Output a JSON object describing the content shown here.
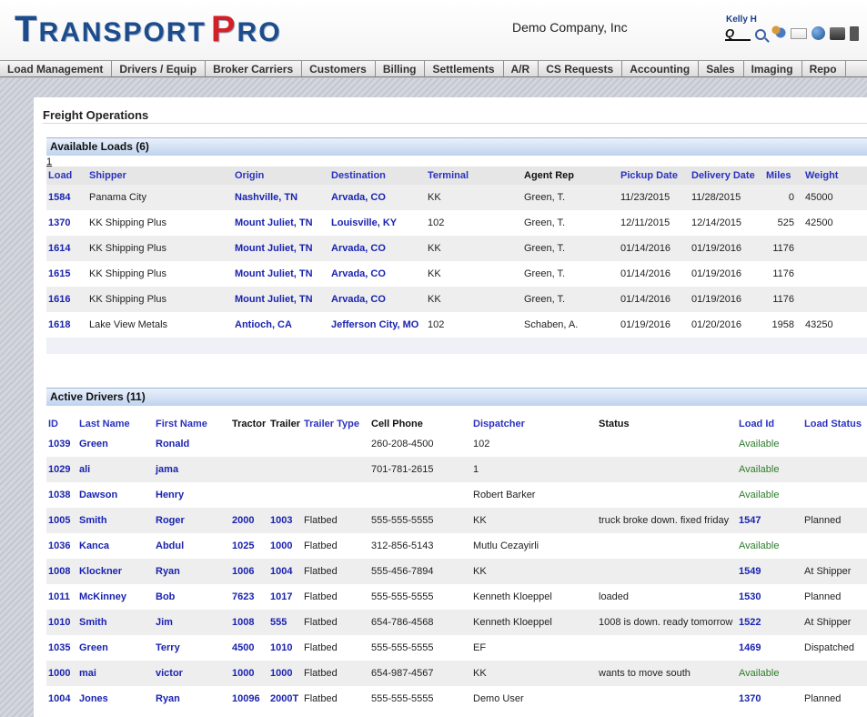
{
  "header": {
    "logo_part1_cap": "T",
    "logo_part1_rest": "RANSPORT",
    "logo_part2_cap": "P",
    "logo_part2_rest": "RO",
    "company": "Demo Company, Inc",
    "user": "Kelly H",
    "icons": [
      "quick-search-icon",
      "search-icon",
      "contacts-icon",
      "mail-icon",
      "globe-icon",
      "print-icon",
      "document-icon"
    ]
  },
  "nav": [
    "Load Management",
    "Drivers / Equip",
    "Broker Carriers",
    "Customers",
    "Billing",
    "Settlements",
    "A/R",
    "CS Requests",
    "Accounting",
    "Sales",
    "Imaging",
    "Repo"
  ],
  "page": {
    "title": "Freight Operations"
  },
  "loads": {
    "heading": "Available Loads (6)",
    "pager": "1",
    "columns": [
      "Load",
      "Shipper",
      "Origin",
      "Destination",
      "Terminal",
      "Agent Rep",
      "Pickup Date",
      "Delivery Date",
      "Miles",
      "Weight"
    ],
    "rows": [
      {
        "load": "1584",
        "shipper": "Panama City",
        "origin": "Nashville, TN",
        "destination": "Arvada, CO",
        "terminal": "KK",
        "agent": "Green, T.",
        "pickup": "11/23/2015",
        "delivery": "11/28/2015",
        "miles": "0",
        "weight": "45000"
      },
      {
        "load": "1370",
        "shipper": "KK Shipping Plus",
        "origin": "Mount Juliet, TN",
        "destination": "Louisville, KY",
        "terminal": "102",
        "agent": "Green, T.",
        "pickup": "12/11/2015",
        "delivery": "12/14/2015",
        "miles": "525",
        "weight": "42500"
      },
      {
        "load": "1614",
        "shipper": "KK Shipping Plus",
        "origin": "Mount Juliet, TN",
        "destination": "Arvada, CO",
        "terminal": "KK",
        "agent": "Green, T.",
        "pickup": "01/14/2016",
        "delivery": "01/19/2016",
        "miles": "1176",
        "weight": ""
      },
      {
        "load": "1615",
        "shipper": "KK Shipping Plus",
        "origin": "Mount Juliet, TN",
        "destination": "Arvada, CO",
        "terminal": "KK",
        "agent": "Green, T.",
        "pickup": "01/14/2016",
        "delivery": "01/19/2016",
        "miles": "1176",
        "weight": ""
      },
      {
        "load": "1616",
        "shipper": "KK Shipping Plus",
        "origin": "Mount Juliet, TN",
        "destination": "Arvada, CO",
        "terminal": "KK",
        "agent": "Green, T.",
        "pickup": "01/14/2016",
        "delivery": "01/19/2016",
        "miles": "1176",
        "weight": ""
      },
      {
        "load": "1618",
        "shipper": "Lake View Metals",
        "origin": "Antioch, CA",
        "destination": "Jefferson City, MO",
        "terminal": "102",
        "agent": "Schaben, A.",
        "pickup": "01/19/2016",
        "delivery": "01/20/2016",
        "miles": "1958",
        "weight": "43250"
      }
    ]
  },
  "drivers": {
    "heading": "Active Drivers (11)",
    "columns": [
      "ID",
      "Last Name",
      "First Name",
      "Tractor",
      "Trailer",
      "Trailer Type",
      "Cell Phone",
      "Dispatcher",
      "Status",
      "Load Id",
      "Load Status"
    ],
    "rows": [
      {
        "id": "1039",
        "last": "Green",
        "first": "Ronald",
        "tractor": "",
        "trailer": "",
        "type": "",
        "phone": "260-208-4500",
        "dispatcher": "102",
        "status": "",
        "load_id": "Available",
        "load_status": ""
      },
      {
        "id": "1029",
        "last": "ali",
        "first": "jama",
        "tractor": "",
        "trailer": "",
        "type": "",
        "phone": "701-781-2615",
        "dispatcher": "1",
        "status": "",
        "load_id": "Available",
        "load_status": ""
      },
      {
        "id": "1038",
        "last": "Dawson",
        "first": "Henry",
        "tractor": "",
        "trailer": "",
        "type": "",
        "phone": "",
        "dispatcher": "Robert Barker",
        "status": "",
        "load_id": "Available",
        "load_status": ""
      },
      {
        "id": "1005",
        "last": "Smith",
        "first": "Roger",
        "tractor": "2000",
        "trailer": "1003",
        "type": "Flatbed",
        "phone": "555-555-5555",
        "dispatcher": "KK",
        "status": "truck broke down. fixed friday",
        "load_id": "1547",
        "load_status": "Planned"
      },
      {
        "id": "1036",
        "last": "Kanca",
        "first": "Abdul",
        "tractor": "1025",
        "trailer": "1000",
        "type": "Flatbed",
        "phone": "312-856-5143",
        "dispatcher": "Mutlu Cezayirli",
        "status": "",
        "load_id": "Available",
        "load_status": ""
      },
      {
        "id": "1008",
        "last": "Klockner",
        "first": "Ryan",
        "tractor": "1006",
        "trailer": "1004",
        "type": "Flatbed",
        "phone": "555-456-7894",
        "dispatcher": "KK",
        "status": "",
        "load_id": "1549",
        "load_status": "At Shipper"
      },
      {
        "id": "1011",
        "last": "McKinney",
        "first": "Bob",
        "tractor": "7623",
        "trailer": "1017",
        "type": "Flatbed",
        "phone": "555-555-5555",
        "dispatcher": "Kenneth Kloeppel",
        "status": "loaded",
        "load_id": "1530",
        "load_status": "Planned"
      },
      {
        "id": "1010",
        "last": "Smith",
        "first": "Jim",
        "tractor": "1008",
        "trailer": "555",
        "type": "Flatbed",
        "phone": "654-786-4568",
        "dispatcher": "Kenneth Kloeppel",
        "status": "1008 is down. ready tomorrow",
        "load_id": "1522",
        "load_status": "At Shipper"
      },
      {
        "id": "1035",
        "last": "Green",
        "first": "Terry",
        "tractor": "4500",
        "trailer": "1010",
        "type": "Flatbed",
        "phone": "555-555-5555",
        "dispatcher": "EF",
        "status": "",
        "load_id": "1469",
        "load_status": "Dispatched"
      },
      {
        "id": "1000",
        "last": "mai",
        "first": "victor",
        "tractor": "1000",
        "trailer": "1000",
        "type": "Flatbed",
        "phone": "654-987-4567",
        "dispatcher": "KK",
        "status": "wants to move south",
        "load_id": "Available",
        "load_status": ""
      },
      {
        "id": "1004",
        "last": "Jones",
        "first": "Ryan",
        "tractor": "10096",
        "trailer": "2000T",
        "type": "Flatbed",
        "phone": "555-555-5555",
        "dispatcher": "Demo User",
        "status": "",
        "load_id": "1370",
        "load_status": "Planned"
      }
    ]
  },
  "colors": {
    "logo_blue": "#1c4c8c",
    "logo_red": "#d32027",
    "link_blue": "#1a23b0",
    "available_green": "#2c7d2a",
    "section_header": "#bfd3ee"
  }
}
